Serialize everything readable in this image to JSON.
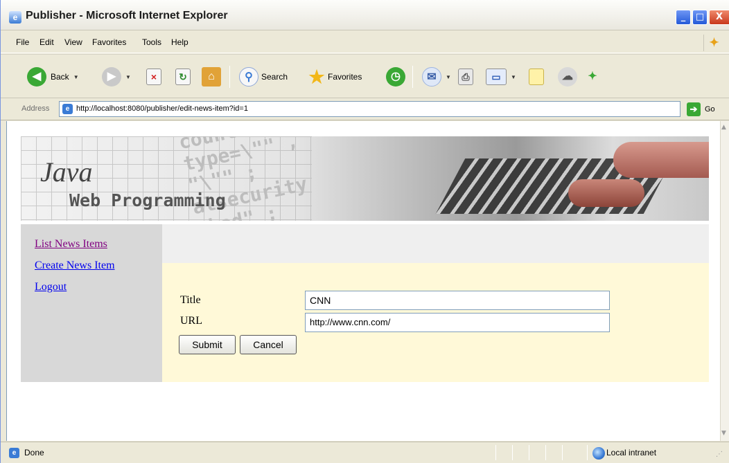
{
  "window": {
    "title": "Publisher - Microsoft Internet Explorer",
    "controls": {
      "minimize": "_",
      "maximize": "□",
      "close": "X"
    }
  },
  "menu": {
    "items": [
      "File",
      "Edit",
      "View",
      "Favorites",
      "Tools",
      "Help"
    ]
  },
  "toolbar": {
    "back_label": "Back",
    "search_label": "Search",
    "favorites_label": "Favorites",
    "icons": [
      "back-icon",
      "forward-icon",
      "stop-icon",
      "refresh-icon",
      "home-icon",
      "search-icon",
      "favorites-star-icon",
      "history-icon",
      "mail-icon",
      "print-icon",
      "edit-icon",
      "discuss-icon",
      "messenger-icon",
      "research-icon"
    ]
  },
  "address": {
    "label": "Address",
    "url": "http://localhost:8080/publisher/edit-news-item?id=1",
    "go_label": "Go"
  },
  "banner": {
    "title": "Java",
    "subtitle": "Web Programming",
    "code_text": "count ;\ntype=\\\"\" ,\n\"\\\"\" ;\nalsecurity\ncked\" ;"
  },
  "sidebar": {
    "links": [
      "List News Items",
      "Create News Item",
      "Logout"
    ]
  },
  "form": {
    "title_label": "Title",
    "title_value": "CNN",
    "url_label": "URL",
    "url_value": "http://www.cnn.com/",
    "submit_label": "Submit",
    "cancel_label": "Cancel"
  },
  "status": {
    "text": "Done",
    "zone": "Local intranet"
  },
  "colors": {
    "link": "#0000ee",
    "visited_link": "#800080",
    "sidebar_bg": "#d8d8d8",
    "form_bg": "#fff9d8",
    "chrome_bg": "#ece9d8"
  }
}
